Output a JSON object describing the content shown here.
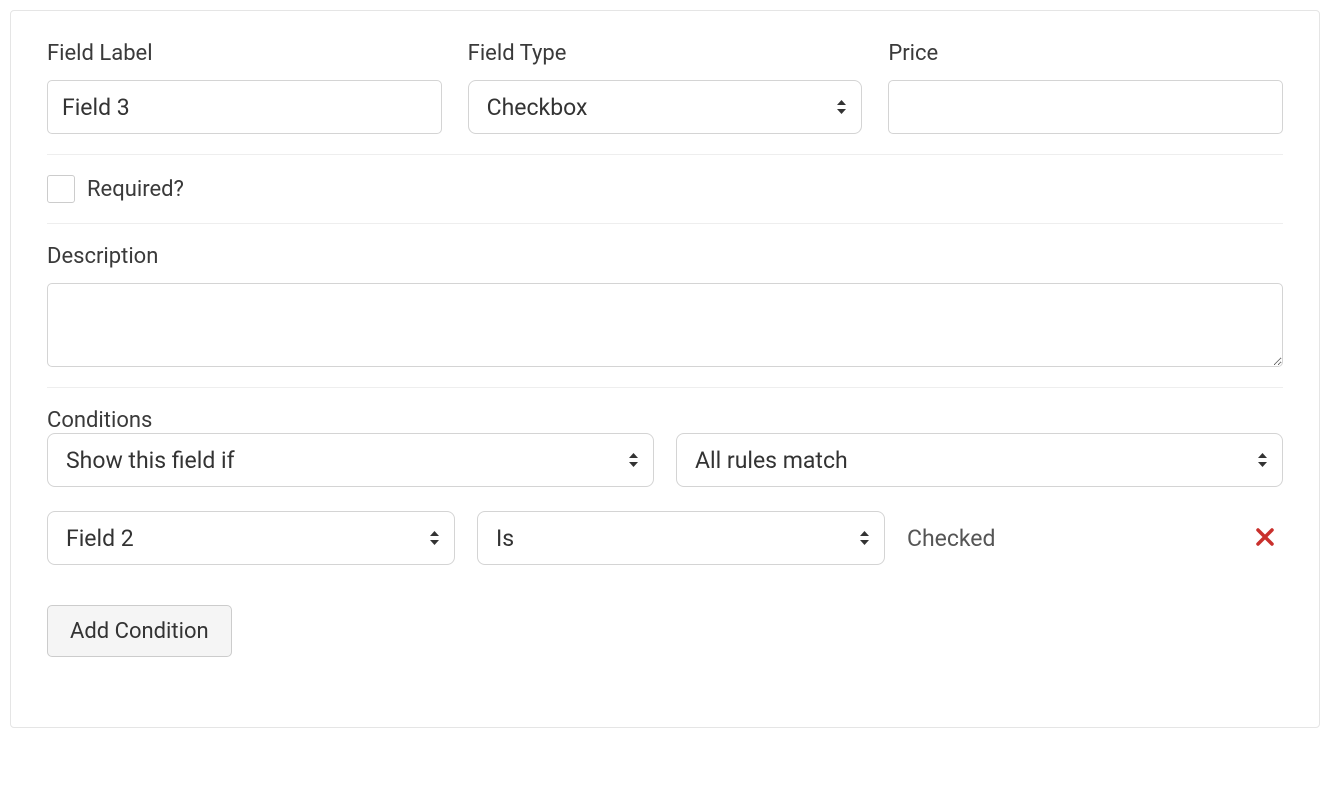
{
  "labels": {
    "field_label": "Field Label",
    "field_type": "Field Type",
    "price": "Price",
    "required": "Required?",
    "description": "Description",
    "conditions": "Conditions"
  },
  "field": {
    "label_value": "Field 3",
    "type_value": "Checkbox",
    "price_value": "",
    "required_checked": false,
    "description_value": ""
  },
  "conditions": {
    "action": "Show this field if",
    "match": "All rules match",
    "rules": [
      {
        "field": "Field 2",
        "operator": "Is",
        "value": "Checked"
      }
    ]
  },
  "buttons": {
    "add_condition": "Add Condition"
  }
}
